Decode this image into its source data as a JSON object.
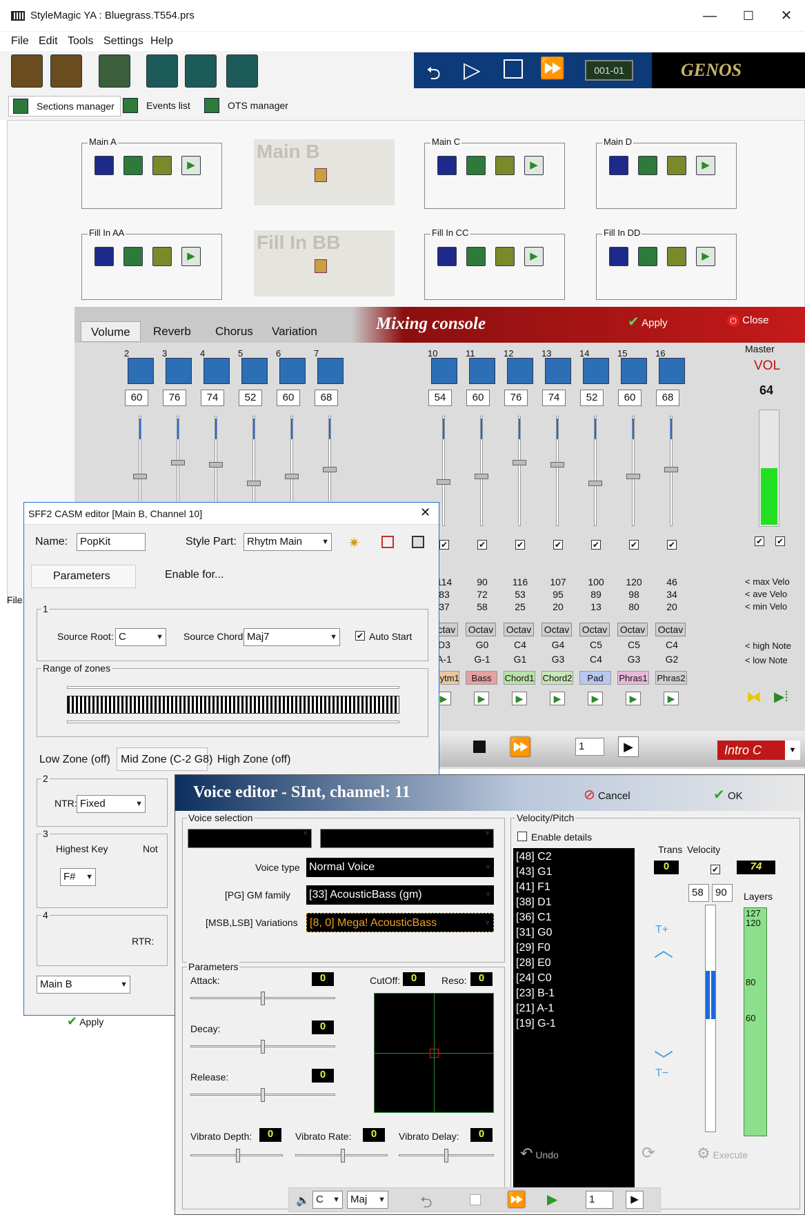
{
  "window": {
    "title": "StyleMagic YA : Bluegrass.T554.prs",
    "min": "—",
    "max": "☐",
    "close": "✕"
  },
  "menu": [
    "File",
    "Edit",
    "Tools",
    "Settings",
    "Help"
  ],
  "transport": {
    "position": "001-01",
    "device": "GENOS"
  },
  "tabs": [
    "Sections manager",
    "Events list",
    "OTS manager"
  ],
  "sections": [
    {
      "label": "Main A",
      "enabled": true
    },
    {
      "label": "Main B",
      "enabled": false
    },
    {
      "label": "Main C",
      "enabled": true
    },
    {
      "label": "Main D",
      "enabled": true
    },
    {
      "label": "Fill In AA",
      "enabled": true
    },
    {
      "label": "Fill In BB",
      "enabled": false
    },
    {
      "label": "Fill In CC",
      "enabled": true
    },
    {
      "label": "Fill In DD",
      "enabled": true
    }
  ],
  "mixer": {
    "tabs": [
      "Volume",
      "Reverb",
      "Chorus",
      "Variation"
    ],
    "title": "Mixing console",
    "apply": "Apply",
    "close": "Close",
    "channels_left": [
      {
        "num": "2",
        "val": "60"
      },
      {
        "num": "3",
        "val": "76"
      },
      {
        "num": "4",
        "val": "74"
      },
      {
        "num": "5",
        "val": "52"
      },
      {
        "num": "6",
        "val": "60"
      },
      {
        "num": "7",
        "val": "68"
      }
    ],
    "channels": [
      {
        "num": "10",
        "val": "54",
        "max": "114",
        "ave": "83",
        "min": "37",
        "high": "D3",
        "low": "A-1",
        "part": "Rhytm1",
        "color": "#e9c7a0"
      },
      {
        "num": "11",
        "val": "60",
        "max": "90",
        "ave": "72",
        "min": "58",
        "high": "G0",
        "low": "G-1",
        "part": "Bass",
        "color": "#e6a0a0"
      },
      {
        "num": "12",
        "val": "76",
        "max": "116",
        "ave": "53",
        "min": "25",
        "high": "C4",
        "low": "G1",
        "part": "Chord1",
        "color": "#b9e2a9"
      },
      {
        "num": "13",
        "val": "74",
        "max": "107",
        "ave": "95",
        "min": "20",
        "high": "G4",
        "low": "G3",
        "part": "Chord2",
        "color": "#c8e6b8"
      },
      {
        "num": "14",
        "val": "52",
        "max": "100",
        "ave": "89",
        "min": "13",
        "high": "C5",
        "low": "C4",
        "part": "Pad",
        "color": "#b7c7f0"
      },
      {
        "num": "15",
        "val": "60",
        "max": "120",
        "ave": "98",
        "min": "80",
        "high": "C5",
        "low": "G3",
        "part": "Phras1",
        "color": "#e8b8d8"
      },
      {
        "num": "16",
        "val": "68",
        "max": "46",
        "ave": "34",
        "min": "20",
        "high": "C4",
        "low": "G2",
        "part": "Phras2",
        "color": "#d0d0d0"
      }
    ],
    "octav": "Octav",
    "master": {
      "label": "Master",
      "vol_label": "VOL",
      "vol": "64",
      "level": 0.5
    },
    "legend": {
      "max": "< max Velo",
      "ave": "< ave Velo",
      "min": "< min Velo",
      "high": "< high Note",
      "low": "< low Note"
    },
    "bottom": {
      "bar": "1",
      "section": "Intro C"
    }
  },
  "side_file_label": "File",
  "casm": {
    "title": "SFF2 CASM editor [Main B, Channel 10]",
    "name_label": "Name:",
    "name": "PopKit",
    "style_part_label": "Style Part:",
    "style_part": "Rhytm Main",
    "tab_params": "Parameters",
    "tab_enable": "Enable for...",
    "g1": "1",
    "source_root_label": "Source Root:",
    "source_root": "C",
    "source_chord_label": "Source Chord:",
    "source_chord": "Maj7",
    "auto_start": "Auto Start",
    "range_label": "Range of zones",
    "zone_low": "Low Zone (off)",
    "zone_mid": "Mid Zone (C-2 G8)",
    "zone_high": "High Zone (off)",
    "g2": "2",
    "ntr_label": "NTR:",
    "ntr": "Fixed",
    "g3": "3",
    "highest_key_label": "Highest Key",
    "note_label": "Not",
    "highest_key": "F#",
    "g4": "4",
    "rtr_label": "RTR:",
    "section_select": "Main B",
    "apply": "Apply"
  },
  "voice": {
    "title": "Voice editor - SInt, channel: 11",
    "cancel": "Cancel",
    "ok": "OK",
    "voice_selection": "Voice selection",
    "voice_type_label": "Voice type",
    "voice_type": "Normal Voice",
    "gm_label": "[PG] GM family",
    "gm": "[33] AcousticBass (gm)",
    "var_label": "[MSB,LSB] Variations",
    "var": "[8, 0] Mega! AcousticBass",
    "params": "Parameters",
    "attack_label": "Attack:",
    "attack": "0",
    "decay_label": "Decay:",
    "decay": "0",
    "release_label": "Release:",
    "release": "0",
    "cutoff_label": "CutOff:",
    "cutoff": "0",
    "reso_label": "Reso:",
    "reso": "0",
    "vdepth_label": "Vibrato Depth:",
    "vdepth": "0",
    "vrate_label": "Vibrato Rate:",
    "vrate": "0",
    "vdelay_label": "Vibrato Delay:",
    "vdelay": "0",
    "velpitch": "Velocity/Pitch",
    "enable_details": "Enable details",
    "notes": [
      "[48] C2",
      "[43] G1",
      "[41] F1",
      "[38] D1",
      "[36] C1",
      "[31] G0",
      "[29] F0",
      "[28] E0",
      "[24] C0",
      "[23] B-1",
      "[21] A-1",
      "[19] G-1"
    ],
    "trans_label": "Trans",
    "trans": "0",
    "velocity_label": "Velocity",
    "velocity": "74",
    "vel_low": "58",
    "vel_high": "90",
    "trans_up": "T+",
    "trans_down": "T−",
    "layers_label": "Layers",
    "layers": [
      "127",
      "120",
      "80",
      "60"
    ],
    "undo": "Undo",
    "execute": "Execute",
    "bottom": {
      "key": "C",
      "chord": "Maj",
      "bar": "1"
    }
  }
}
